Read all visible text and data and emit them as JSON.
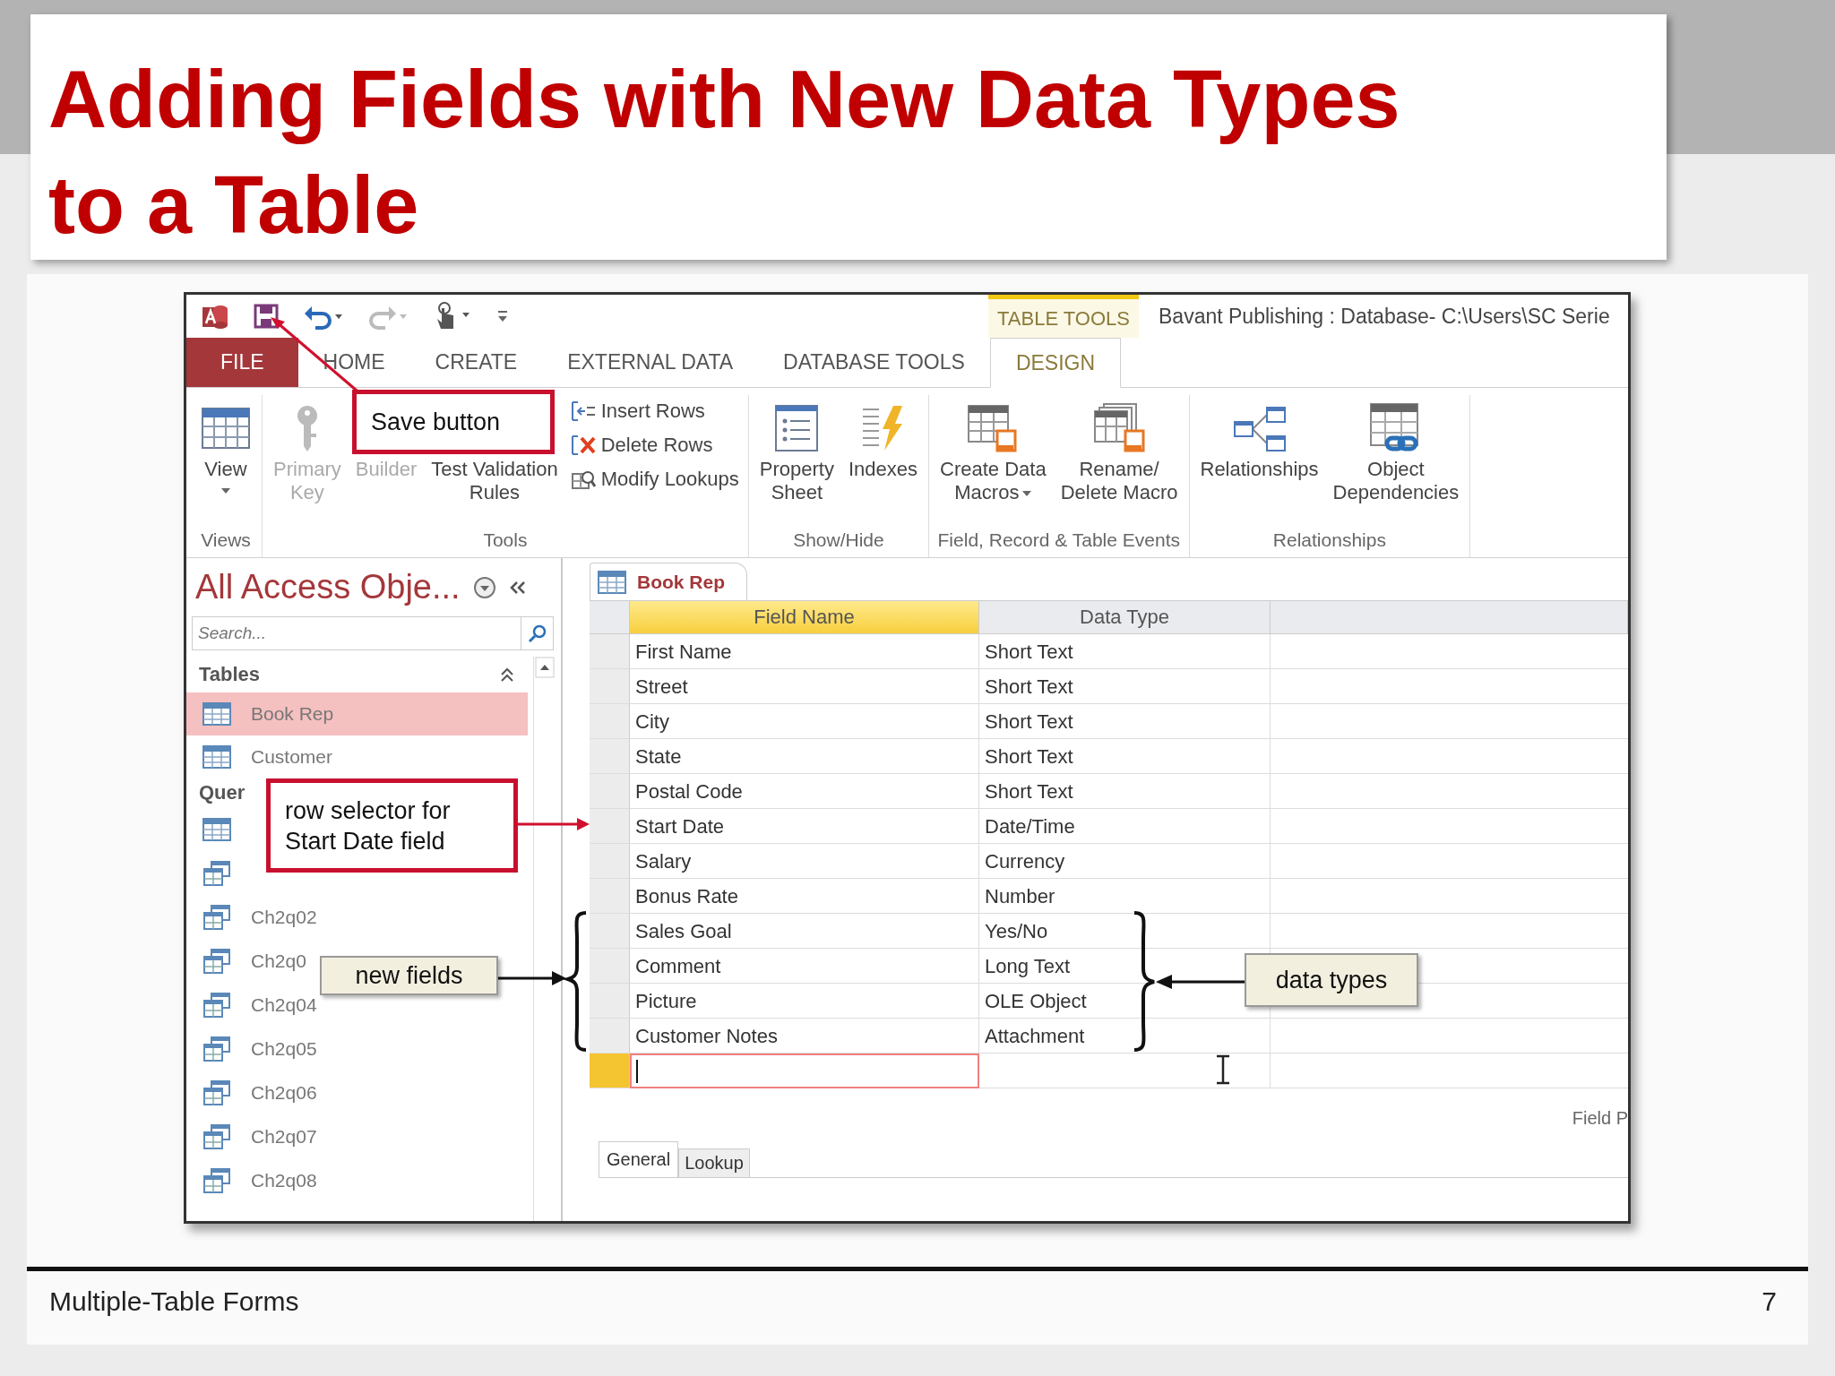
{
  "slide": {
    "title": "Adding Fields with New Data Types to a Table",
    "footer": "Multiple-Table Forms",
    "page_number": "7"
  },
  "window": {
    "quick_access": [
      {
        "disabled": false
      },
      {
        "disabled": false
      },
      {
        "disabled": true
      },
      {
        "disabled": false
      }
    ],
    "contextual_group": "TABLE TOOLS",
    "title": "Bavant Publishing : Database- C:\\Users\\SC Serie"
  },
  "ribbon_tabs": [
    {
      "label": "FILE",
      "kind": "file",
      "selected": false
    },
    {
      "label": "HOME",
      "kind": "tab",
      "selected": false
    },
    {
      "label": "CREATE",
      "kind": "tab",
      "selected": false
    },
    {
      "label": "EXTERNAL DATA",
      "kind": "tab",
      "selected": false
    },
    {
      "label": "DATABASE TOOLS",
      "kind": "tab",
      "selected": false
    },
    {
      "label": "DESIGN",
      "kind": "contextual",
      "selected": true
    }
  ],
  "ribbon_groups": [
    {
      "label": "Views",
      "buttons": [
        {
          "kind": "large",
          "lines": [
            "View"
          ],
          "dropdown": true,
          "disabled": false
        }
      ]
    },
    {
      "label": "Tools",
      "buttons": [
        {
          "kind": "large",
          "lines": [
            "Primary",
            "Key"
          ],
          "dropdown": false,
          "disabled": true
        },
        {
          "kind": "large",
          "lines": [
            "Builder"
          ],
          "dropdown": false,
          "disabled": true
        },
        {
          "kind": "large",
          "lines": [
            "Test Validation",
            "Rules"
          ],
          "dropdown": false,
          "disabled": false
        },
        {
          "kind": "small",
          "label": "Insert Rows"
        },
        {
          "kind": "small",
          "label": "Delete Rows"
        },
        {
          "kind": "small",
          "label": "Modify Lookups"
        }
      ]
    },
    {
      "label": "Show/Hide",
      "buttons": [
        {
          "kind": "large",
          "lines": [
            "Property",
            "Sheet"
          ],
          "dropdown": false,
          "disabled": false
        },
        {
          "kind": "large",
          "lines": [
            "Indexes"
          ],
          "dropdown": false,
          "disabled": false
        }
      ]
    },
    {
      "label": "Field, Record & Table Events",
      "buttons": [
        {
          "kind": "large",
          "lines": [
            "Create Data",
            "Macros"
          ],
          "dropdown": true,
          "disabled": false
        },
        {
          "kind": "large",
          "lines": [
            "Rename/",
            "Delete Macro"
          ],
          "dropdown": false,
          "disabled": false
        }
      ]
    },
    {
      "label": "Relationships",
      "buttons": [
        {
          "kind": "large",
          "lines": [
            "Relationships"
          ],
          "dropdown": false,
          "disabled": false
        },
        {
          "kind": "large",
          "lines": [
            "Object",
            "Dependencies"
          ],
          "dropdown": false,
          "disabled": false
        }
      ]
    }
  ],
  "navigation_pane": {
    "title": "All Access Obje...",
    "search_placeholder": "Search...",
    "groups": [
      {
        "label": "Tables",
        "expanded": true,
        "items": [
          {
            "kind": "table",
            "name": "Book Rep",
            "selected": true
          },
          {
            "kind": "table",
            "name": "Customer",
            "selected": false
          }
        ]
      },
      {
        "label": "Quer",
        "items": [
          {
            "kind": "table",
            "selected": false
          },
          {
            "kind": "query",
            "selected": false
          },
          {
            "kind": "query",
            "name": "Ch2q02",
            "selected": false
          },
          {
            "kind": "query",
            "name": "Ch2q0",
            "selected": false
          },
          {
            "kind": "query",
            "name": "Ch2q04",
            "selected": false
          },
          {
            "kind": "query",
            "name": "Ch2q05",
            "selected": false
          },
          {
            "kind": "query",
            "name": "Ch2q06",
            "selected": false
          },
          {
            "kind": "query",
            "name": "Ch2q07",
            "selected": false
          },
          {
            "kind": "query",
            "name": "Ch2q08",
            "selected": false
          }
        ]
      }
    ]
  },
  "document": {
    "tab": "Book Rep",
    "columns": [
      {
        "label": "Field Name",
        "selected": true
      },
      {
        "label": "Data Type",
        "selected": false
      }
    ],
    "rows": [
      {
        "field": "First Name",
        "type": "Short Text",
        "current": false
      },
      {
        "field": "Street",
        "type": "Short Text",
        "current": false
      },
      {
        "field": "City",
        "type": "Short Text",
        "current": false
      },
      {
        "field": "State",
        "type": "Short Text",
        "current": false
      },
      {
        "field": "Postal Code",
        "type": "Short Text",
        "current": false
      },
      {
        "field": "Start Date",
        "type": "Date/Time",
        "current": false
      },
      {
        "field": "Salary",
        "type": "Currency",
        "current": false
      },
      {
        "field": "Bonus Rate",
        "type": "Number",
        "current": false
      },
      {
        "field": "Sales Goal",
        "type": "Yes/No",
        "current": false
      },
      {
        "field": "Comment",
        "type": "Long Text",
        "current": false
      },
      {
        "field": "Picture",
        "type": "OLE Object",
        "current": false
      },
      {
        "field": "Customer Notes",
        "type": "Attachment",
        "current": false
      },
      {
        "current": true
      }
    ],
    "properties_label": "Field P",
    "property_tabs": [
      {
        "label": "General",
        "selected": true
      },
      {
        "label": "Lookup",
        "selected": false
      }
    ]
  },
  "callouts": [
    {
      "kind": "red",
      "text": "Save button"
    },
    {
      "kind": "red",
      "text": "row selector for Start Date field"
    },
    {
      "kind": "note",
      "text": "new fields"
    },
    {
      "kind": "note",
      "text": "data types"
    }
  ]
}
